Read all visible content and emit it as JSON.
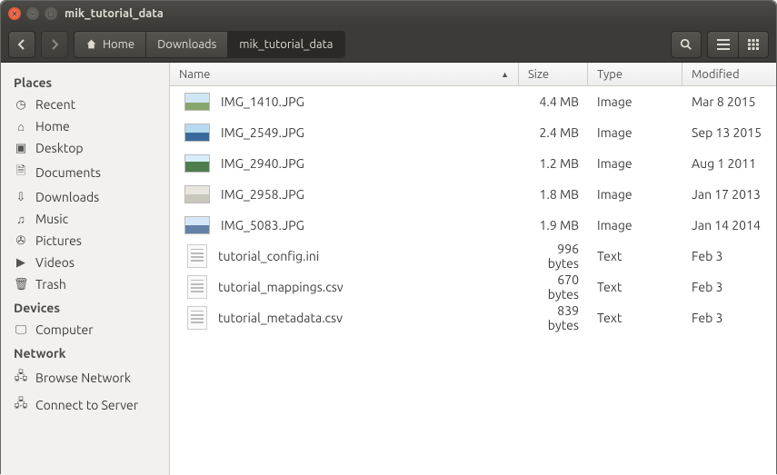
{
  "window": {
    "title": "mik_tutorial_data"
  },
  "breadcrumb": {
    "home": "Home",
    "items": [
      "Downloads",
      "mik_tutorial_data"
    ]
  },
  "sidebar": {
    "headings": {
      "places": "Places",
      "devices": "Devices",
      "network": "Network"
    },
    "places": [
      {
        "icon": "◷",
        "label": "Recent"
      },
      {
        "icon": "⌂",
        "label": "Home"
      },
      {
        "icon": "▣",
        "label": "Desktop"
      },
      {
        "icon": "🗎",
        "label": "Documents"
      },
      {
        "icon": "⇩",
        "label": "Downloads"
      },
      {
        "icon": "♫",
        "label": "Music"
      },
      {
        "icon": "✇",
        "label": "Pictures"
      },
      {
        "icon": "▶",
        "label": "Videos"
      },
      {
        "icon": "🗑",
        "label": "Trash"
      }
    ],
    "devices": [
      {
        "icon": "🖵",
        "label": "Computer"
      }
    ],
    "network": [
      {
        "icon": "🖧",
        "label": "Browse Network"
      },
      {
        "icon": "🖧",
        "label": "Connect to Server"
      }
    ]
  },
  "columns": {
    "name": "Name",
    "size": "Size",
    "type": "Type",
    "modified": "Modified"
  },
  "files": [
    {
      "name": "IMG_1410.JPG",
      "size": "4.4 MB",
      "type": "Image",
      "modified": "Mar 8 2015",
      "thumb": "img a"
    },
    {
      "name": "IMG_2549.JPG",
      "size": "2.4 MB",
      "type": "Image",
      "modified": "Sep 13 2015",
      "thumb": "img b"
    },
    {
      "name": "IMG_2940.JPG",
      "size": "1.2 MB",
      "type": "Image",
      "modified": "Aug 1 2011",
      "thumb": "img c"
    },
    {
      "name": "IMG_2958.JPG",
      "size": "1.8 MB",
      "type": "Image",
      "modified": "Jan 17 2013",
      "thumb": "img d"
    },
    {
      "name": "IMG_5083.JPG",
      "size": "1.9 MB",
      "type": "Image",
      "modified": "Jan 14 2014",
      "thumb": "img e"
    },
    {
      "name": "tutorial_config.ini",
      "size": "996 bytes",
      "type": "Text",
      "modified": "Feb 3",
      "thumb": "txt"
    },
    {
      "name": "tutorial_mappings.csv",
      "size": "670 bytes",
      "type": "Text",
      "modified": "Feb 3",
      "thumb": "txt"
    },
    {
      "name": "tutorial_metadata.csv",
      "size": "839 bytes",
      "type": "Text",
      "modified": "Feb 3",
      "thumb": "txt"
    }
  ]
}
